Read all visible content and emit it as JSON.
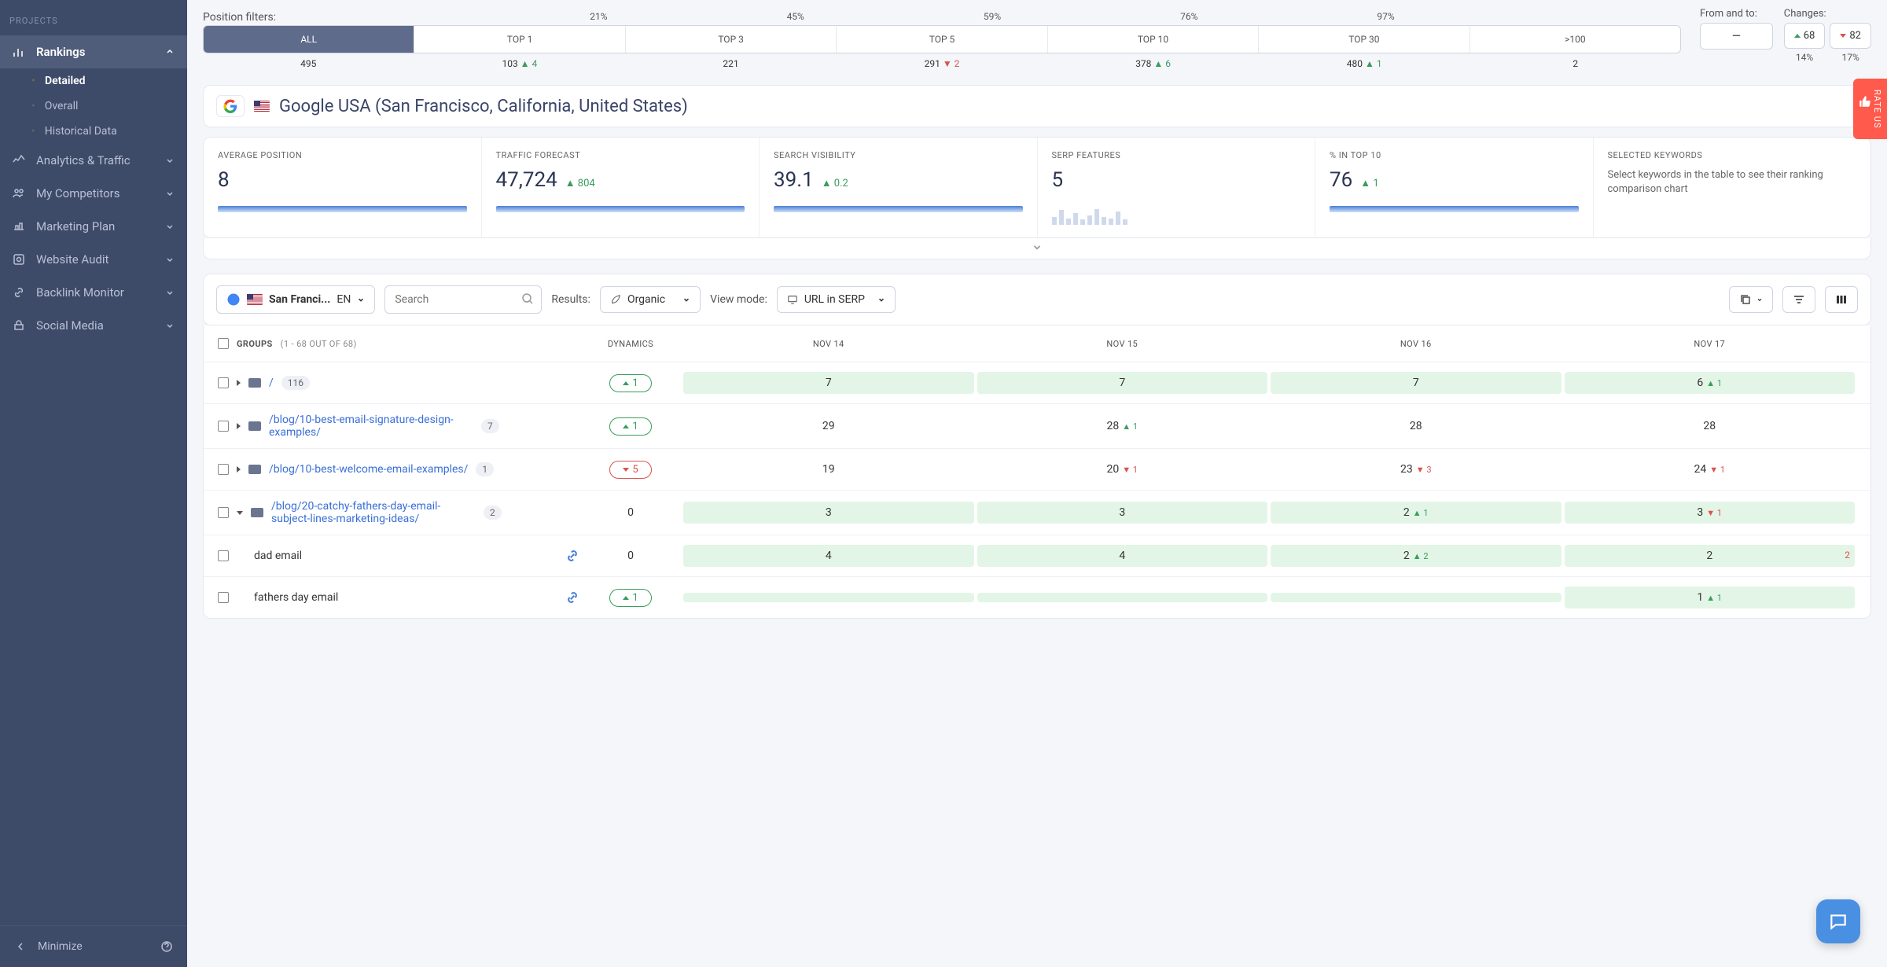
{
  "sidebar": {
    "header": "PROJECTS",
    "items": [
      {
        "label": "Rankings",
        "active": true,
        "sub": [
          {
            "label": "Detailed",
            "active": true
          },
          {
            "label": "Overall"
          },
          {
            "label": "Historical Data"
          }
        ]
      },
      {
        "label": "Analytics & Traffic"
      },
      {
        "label": "My Competitors"
      },
      {
        "label": "Marketing Plan"
      },
      {
        "label": "Website Audit"
      },
      {
        "label": "Backlink Monitor"
      },
      {
        "label": "Social Media"
      }
    ],
    "minimize": "Minimize"
  },
  "filters": {
    "label": "Position filters:",
    "top_pct": [
      "",
      "21%",
      "45%",
      "59%",
      "76%",
      "97%",
      ""
    ],
    "tabs": [
      "ALL",
      "TOP 1",
      "TOP 3",
      "TOP 5",
      "TOP 10",
      "TOP 30",
      ">100"
    ],
    "bottom": [
      {
        "v": "495"
      },
      {
        "v": "103",
        "d": "4",
        "dir": "up"
      },
      {
        "v": "221"
      },
      {
        "v": "291",
        "d": "2",
        "dir": "down"
      },
      {
        "v": "378",
        "d": "6",
        "dir": "up"
      },
      {
        "v": "480",
        "d": "1",
        "dir": "up"
      },
      {
        "v": "2"
      }
    ],
    "from_to": {
      "label": "From and to:",
      "value": "—"
    },
    "changes": {
      "label": "Changes:",
      "up": "68",
      "down": "82",
      "up_pct": "14%",
      "down_pct": "17%"
    }
  },
  "engine": {
    "title": "Google USA (San Francisco, California, United States)"
  },
  "metrics": [
    {
      "label": "AVERAGE POSITION",
      "value": "8"
    },
    {
      "label": "TRAFFIC FORECAST",
      "value": "47,724",
      "delta": "804",
      "dir": "up"
    },
    {
      "label": "SEARCH VISIBILITY",
      "value": "39.1",
      "delta": "0.2",
      "dir": "up"
    },
    {
      "label": "SERP FEATURES",
      "value": "5",
      "bars": true
    },
    {
      "label": "% IN TOP 10",
      "value": "76",
      "delta": "1",
      "dir": "up"
    },
    {
      "label": "SELECTED KEYWORDS",
      "hint": "Select keywords in the table to see their ranking comparison chart"
    }
  ],
  "toolbar": {
    "locale": "San Franci...",
    "lang": "EN",
    "search_ph": "Search",
    "results_label": "Results:",
    "results_val": "Organic",
    "view_label": "View mode:",
    "view_val": "URL in SERP"
  },
  "table": {
    "groups_label": "GROUPS",
    "groups_range": "(1 - 68 OUT OF 68)",
    "cols": [
      "DYNAMICS",
      "NOV 14",
      "NOV 15",
      "NOV 16",
      "NOV 17"
    ],
    "rows": [
      {
        "url": "/",
        "count": "116",
        "dyn": {
          "v": "1",
          "dir": "up"
        },
        "cells": [
          {
            "v": "7",
            "hl": true
          },
          {
            "v": "7",
            "hl": true
          },
          {
            "v": "7",
            "hl": true
          },
          {
            "v": "6",
            "d": "1",
            "dir": "up",
            "hl": true
          }
        ],
        "caret": "right"
      },
      {
        "url": "/blog/10-best-email-signature-design-examples/",
        "count": "7",
        "dyn": {
          "v": "1",
          "dir": "up"
        },
        "cells": [
          {
            "v": "29"
          },
          {
            "v": "28",
            "d": "1",
            "dir": "up"
          },
          {
            "v": "28"
          },
          {
            "v": "28"
          }
        ],
        "caret": "right"
      },
      {
        "url": "/blog/10-best-welcome-email-examples/",
        "count": "1",
        "dyn": {
          "v": "5",
          "dir": "down"
        },
        "cells": [
          {
            "v": "19"
          },
          {
            "v": "20",
            "d": "1",
            "dir": "down"
          },
          {
            "v": "23",
            "d": "3",
            "dir": "down"
          },
          {
            "v": "24",
            "d": "1",
            "dir": "down"
          }
        ],
        "caret": "right"
      },
      {
        "url": "/blog/20-catchy-fathers-day-email-subject-lines-marketing-ideas/",
        "count": "2",
        "dyn": {
          "v": "0",
          "plain": true
        },
        "cells": [
          {
            "v": "3",
            "hl": true
          },
          {
            "v": "3",
            "hl": true
          },
          {
            "v": "2",
            "d": "1",
            "dir": "up",
            "hl": true
          },
          {
            "v": "3",
            "d": "1",
            "dir": "down",
            "hl": true
          }
        ],
        "caret": "down"
      },
      {
        "kw": "dad email",
        "dyn": {
          "v": "0",
          "plain": true
        },
        "link": true,
        "cells": [
          {
            "v": "4",
            "hl": true
          },
          {
            "v": "4",
            "hl": true
          },
          {
            "v": "2",
            "d": "2",
            "dir": "up",
            "hl": true
          },
          {
            "v": "2",
            "hl": true,
            "extra_down": true
          }
        ]
      },
      {
        "kw": "fathers day email",
        "dyn": {
          "v": "1",
          "dir": "up"
        },
        "link": true,
        "cells": [
          {
            "v": "",
            "hl": true
          },
          {
            "v": "",
            "hl": true
          },
          {
            "v": "",
            "hl": true
          },
          {
            "v": "1",
            "d": "1",
            "dir": "up",
            "hl": true
          }
        ]
      }
    ]
  },
  "rate": "RATE US"
}
